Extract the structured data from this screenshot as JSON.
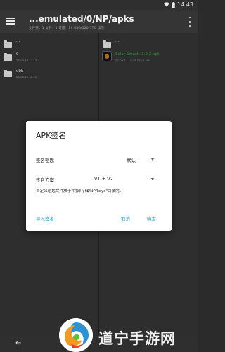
{
  "status_bar": {
    "time": "14:43"
  },
  "toolbar": {
    "path_title": "...emulated/0/NP/apks",
    "path_sub": "文件夹：1  文件：1  可用：19.48G/120.57G  读写"
  },
  "left_panel": {
    "items": [
      {
        "name": "...",
        "date": ""
      },
      {
        "name": "0",
        "date": "23-09-14 13:12"
      },
      {
        "name": "obb",
        "date": "23-06-11 08:56"
      }
    ]
  },
  "right_panel": {
    "items": [
      {
        "name": "...",
        "date": ""
      },
      {
        "name": "Solar Smash_2.0.2.apk",
        "date": "23-09-14 14:43  119.0 MB"
      }
    ]
  },
  "dialog": {
    "title": "APK签名",
    "key_label": "签名密匙",
    "key_value": "默认",
    "scheme_label": "签名方案",
    "scheme_value": "V1 + V2",
    "hint": "自定义密匙文件放于\"内部存储/NP/keys\"目录内。",
    "import_btn": "导入签名",
    "cancel_btn": "取消",
    "confirm_btn": "确定"
  },
  "watermark": {
    "text": "道宁手游网"
  },
  "colors": {
    "accent": "#1e9ed8",
    "apk_name": "#2e9a3c",
    "toolbar": "#353535",
    "background": "#2e2e2e"
  }
}
